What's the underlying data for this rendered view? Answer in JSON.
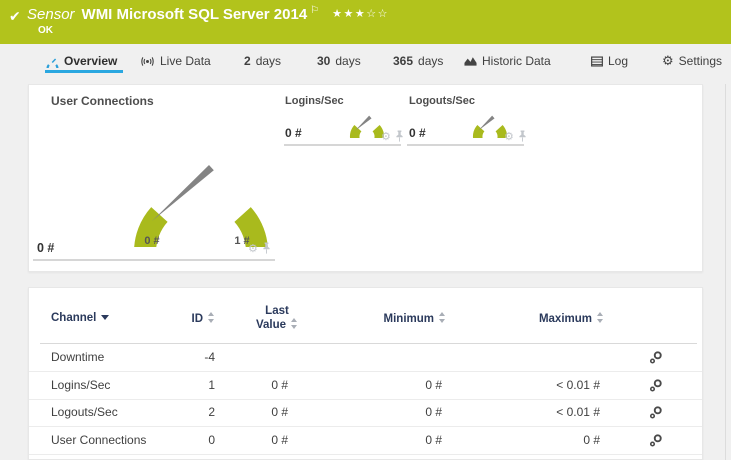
{
  "header": {
    "kind": "Sensor",
    "title": "WMI Microsoft SQL Server 2014",
    "status": "OK",
    "rating": {
      "filled": 3,
      "total": 5,
      "stars_filled": "★★★",
      "stars_empty": "☆☆"
    },
    "color": "#b2c31c"
  },
  "icons": {
    "check": "✔",
    "flag": "⚐",
    "gear": "⚙"
  },
  "tabs": {
    "overview": "Overview",
    "live_data": "Live Data",
    "d2_num": "2",
    "d2_unit": "days",
    "d30_num": "30",
    "d30_unit": "days",
    "d365_num": "365",
    "d365_unit": "days",
    "historic": "Historic Data",
    "log": "Log",
    "settings": "Settings",
    "active_tab": "Overview",
    "active_color": "#2aa7e0"
  },
  "gauges": {
    "color": "#a9ba1d",
    "primary": {
      "title": "User Connections",
      "value": "0 #",
      "scale_min": "0 #",
      "scale_max": "1 #"
    },
    "logins": {
      "title": "Logins/Sec",
      "value": "0 #"
    },
    "logouts": {
      "title": "Logouts/Sec",
      "value": "0 #"
    }
  },
  "table": {
    "headers": {
      "channel": "Channel",
      "id": "ID",
      "last1": "Last",
      "last2": "Value",
      "minimum": "Minimum",
      "maximum": "Maximum"
    },
    "rows": [
      {
        "channel": "Downtime",
        "id": "-4",
        "last": "",
        "min": "",
        "max": ""
      },
      {
        "channel": "Logins/Sec",
        "id": "1",
        "last": "0 #",
        "min": "0 #",
        "max": "< 0.01 #"
      },
      {
        "channel": "Logouts/Sec",
        "id": "2",
        "last": "0 #",
        "min": "0 #",
        "max": "< 0.01 #"
      },
      {
        "channel": "User Connections",
        "id": "0",
        "last": "0 #",
        "min": "0 #",
        "max": "0 #"
      }
    ]
  }
}
